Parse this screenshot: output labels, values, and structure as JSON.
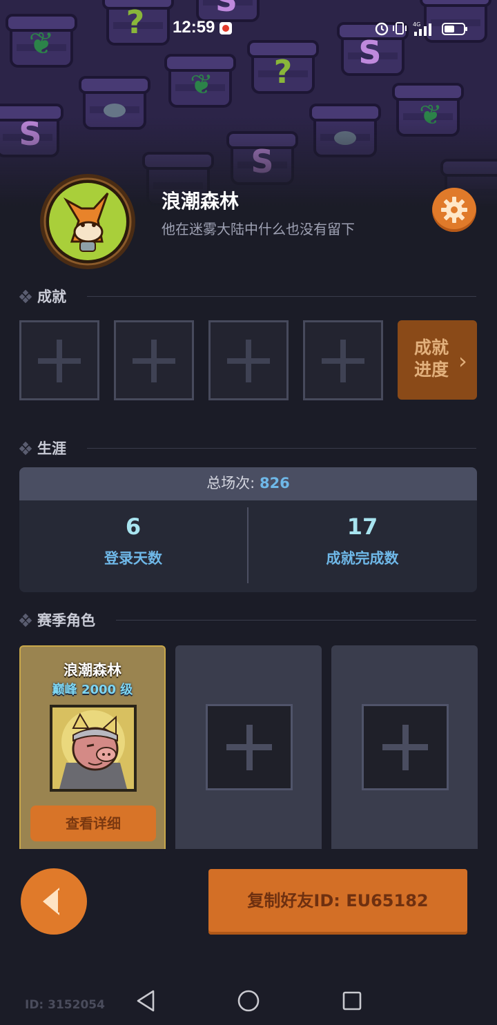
{
  "status_bar": {
    "time": "12:59",
    "network": "4G",
    "icons": [
      "alarm-icon",
      "vibrate-icon",
      "signal-icon",
      "battery-icon"
    ]
  },
  "profile": {
    "name": "浪潮森林",
    "signature": "他在迷雾大陆中什么也没有留下",
    "avatar_icon": "fox-avatar-icon",
    "settings_icon": "gear-icon"
  },
  "achievements": {
    "title": "成就",
    "slot_count": 4,
    "progress_button": "成就\n进度"
  },
  "career": {
    "title": "生涯",
    "total_label": "总场次: ",
    "total_value": "826",
    "stats": [
      {
        "value": "6",
        "label": "登录天数"
      },
      {
        "value": "17",
        "label": "成就完成数"
      }
    ]
  },
  "season": {
    "title": "赛季角色",
    "cards": [
      {
        "name": "浪潮森林",
        "rank": "巅峰 2000 级",
        "button": "查看详细",
        "portrait_icon": "pig-warrior-portrait-icon"
      },
      {
        "empty": true
      },
      {
        "empty": true
      }
    ]
  },
  "footer": {
    "copy_id_button": "复制好友ID: EU65182",
    "user_id": "ID: 3152054"
  },
  "colors": {
    "accent_orange": "#e07a2a",
    "background": "#1b1c27",
    "stat_blue": "#6fb8e8",
    "gold_card": "#9a8450"
  }
}
